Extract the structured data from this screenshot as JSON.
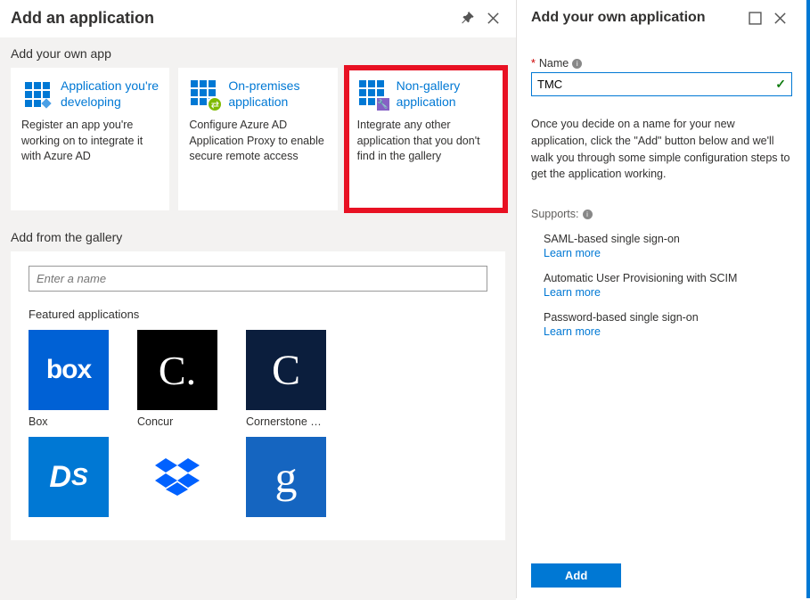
{
  "left": {
    "title": "Add an application",
    "own_app_header": "Add your own app",
    "cards": [
      {
        "title": "Application you're developing",
        "desc": "Register an app you're working on to integrate it with Azure AD",
        "icon": "app-dev"
      },
      {
        "title": "On-premises application",
        "desc": "Configure Azure AD Application Proxy to enable secure remote access",
        "icon": "on-prem"
      },
      {
        "title": "Non-gallery application",
        "desc": "Integrate any other application that you don't find in the gallery",
        "icon": "non-gallery"
      }
    ],
    "gallery_header": "Add from the gallery",
    "search_placeholder": "Enter a name",
    "featured_label": "Featured applications",
    "tiles_row1": [
      {
        "label": "Box",
        "bg": "#0061d5",
        "glyph": "box"
      },
      {
        "label": "Concur",
        "bg": "#000000",
        "glyph": "C."
      },
      {
        "label": "Cornerstone O...",
        "bg": "#0b1e3d",
        "glyph": "C"
      }
    ],
    "tiles_row2": [
      {
        "label": "",
        "bg": "#0078d4",
        "glyph": "DS"
      },
      {
        "label": "",
        "bg": "#ffffff",
        "glyph": "dropbox"
      },
      {
        "label": "",
        "bg": "#1565c0",
        "glyph": "g"
      }
    ]
  },
  "right": {
    "title": "Add your own application",
    "name_label": "Name",
    "name_value": "TMC",
    "help_text": "Once you decide on a name for your new application, click the \"Add\" button below and we'll walk you through some simple configuration steps to get the application working.",
    "supports_label": "Supports:",
    "supports": [
      {
        "title": "SAML-based single sign-on",
        "link": "Learn more"
      },
      {
        "title": "Automatic User Provisioning with SCIM",
        "link": "Learn more"
      },
      {
        "title": "Password-based single sign-on",
        "link": "Learn more"
      }
    ],
    "add_button": "Add"
  }
}
